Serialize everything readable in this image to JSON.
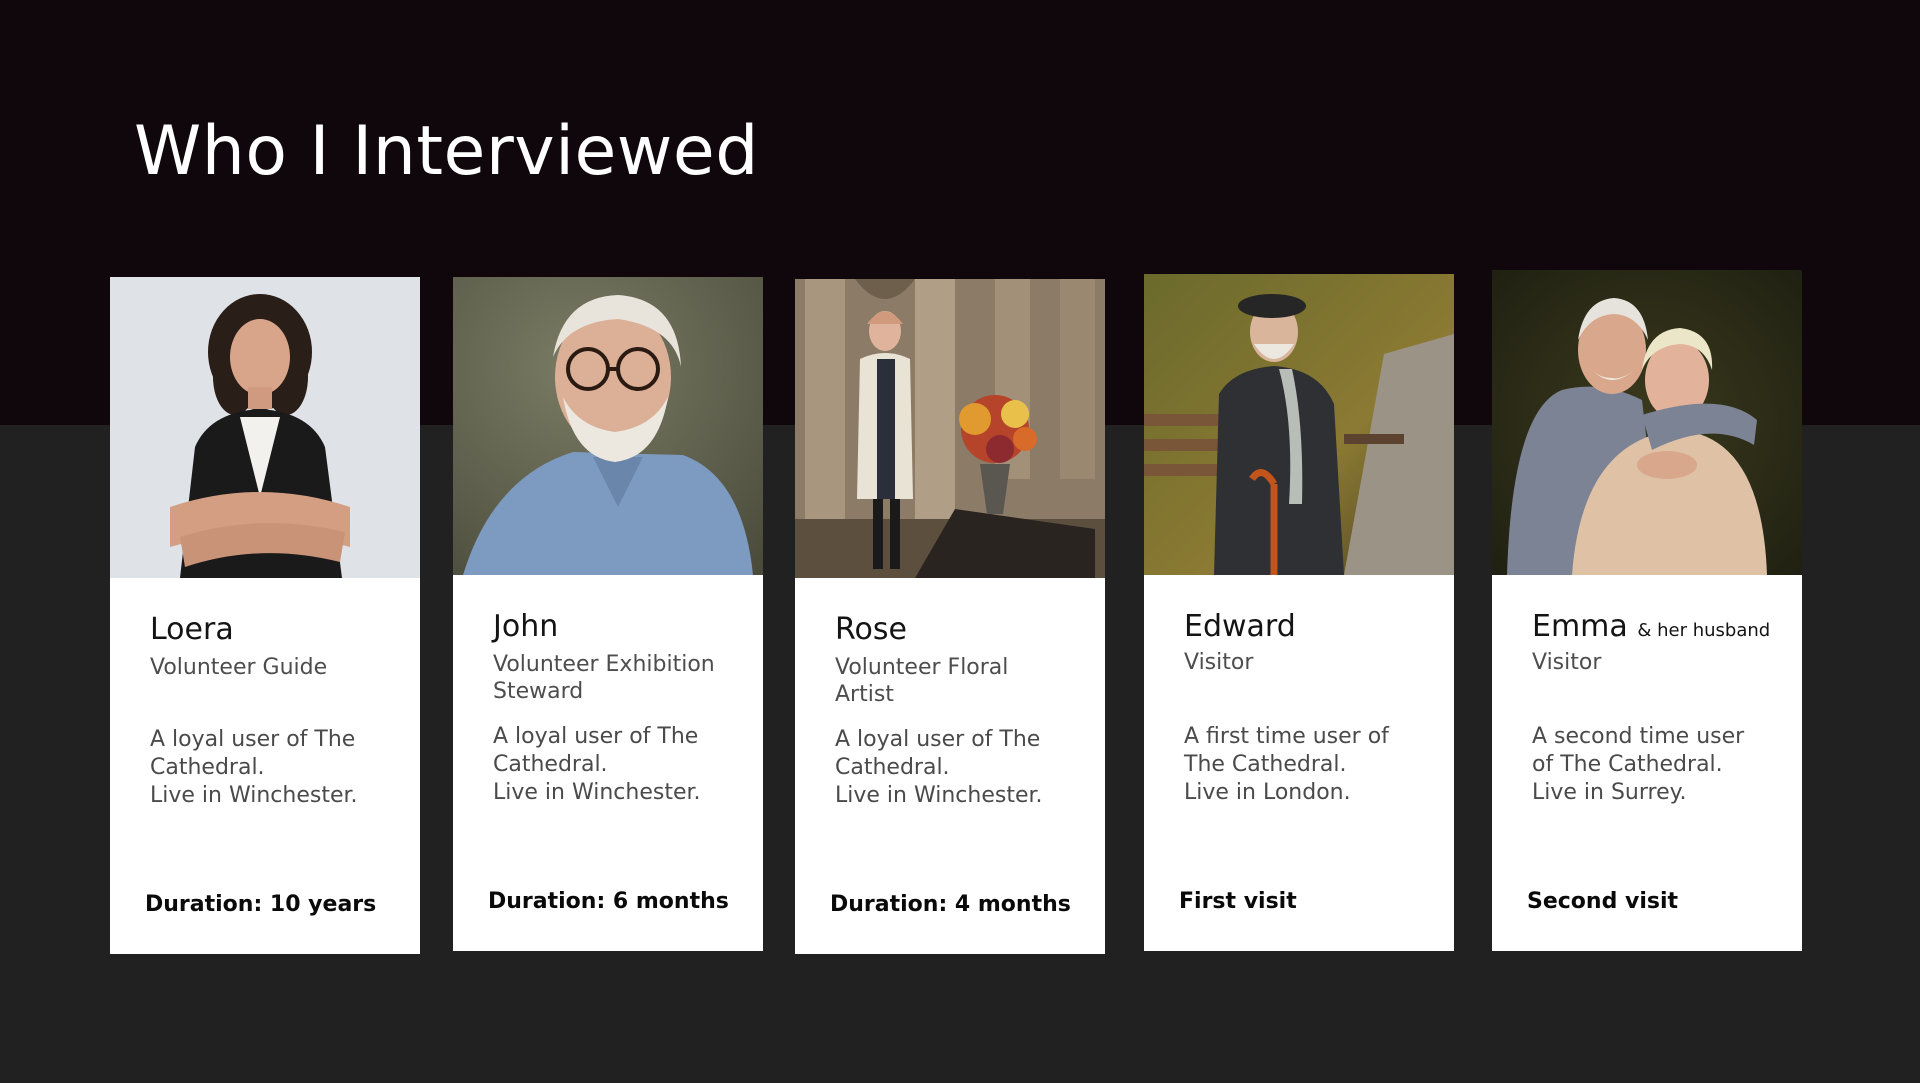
{
  "slide": {
    "title": "Who I Interviewed"
  },
  "colors": {
    "top_band": "#0f070b",
    "bottom_band": "#212121",
    "card_bg": "#ffffff",
    "title_text": "#ffffff"
  },
  "interviewees": [
    {
      "name": "Loera",
      "name_suffix": "",
      "role": "Volunteer Guide",
      "description": [
        "A loyal user of The",
        "Cathedral.",
        "Live in Winchester."
      ],
      "duration": "Duration: 10 years",
      "photo_icon": "portrait-woman-arms-crossed"
    },
    {
      "name": "John",
      "name_suffix": "",
      "role": "Volunteer  Exhibition Steward",
      "description": [
        "A loyal user of The",
        "Cathedral.",
        "Live in Winchester."
      ],
      "duration": "Duration: 6 months",
      "photo_icon": "portrait-older-man-glasses"
    },
    {
      "name": "Rose",
      "name_suffix": "",
      "role": "Volunteer  Floral Artist",
      "description": [
        "A loyal user of The",
        "Cathedral.",
        "Live in Winchester."
      ],
      "duration": "Duration: 4 months",
      "photo_icon": "portrait-woman-cathedral-flowers"
    },
    {
      "name": "Edward",
      "name_suffix": "",
      "role": "Visitor",
      "description": [
        "A first time user of",
        "The Cathedral.",
        "Live in London."
      ],
      "duration": "First visit",
      "photo_icon": "portrait-man-park-bench"
    },
    {
      "name": "Emma",
      "name_suffix": "& her husband",
      "role": "Visitor",
      "description": [
        "A second time user",
        "of The Cathedral.",
        "Live in Surrey."
      ],
      "duration": "Second visit",
      "photo_icon": "portrait-elderly-couple"
    }
  ]
}
